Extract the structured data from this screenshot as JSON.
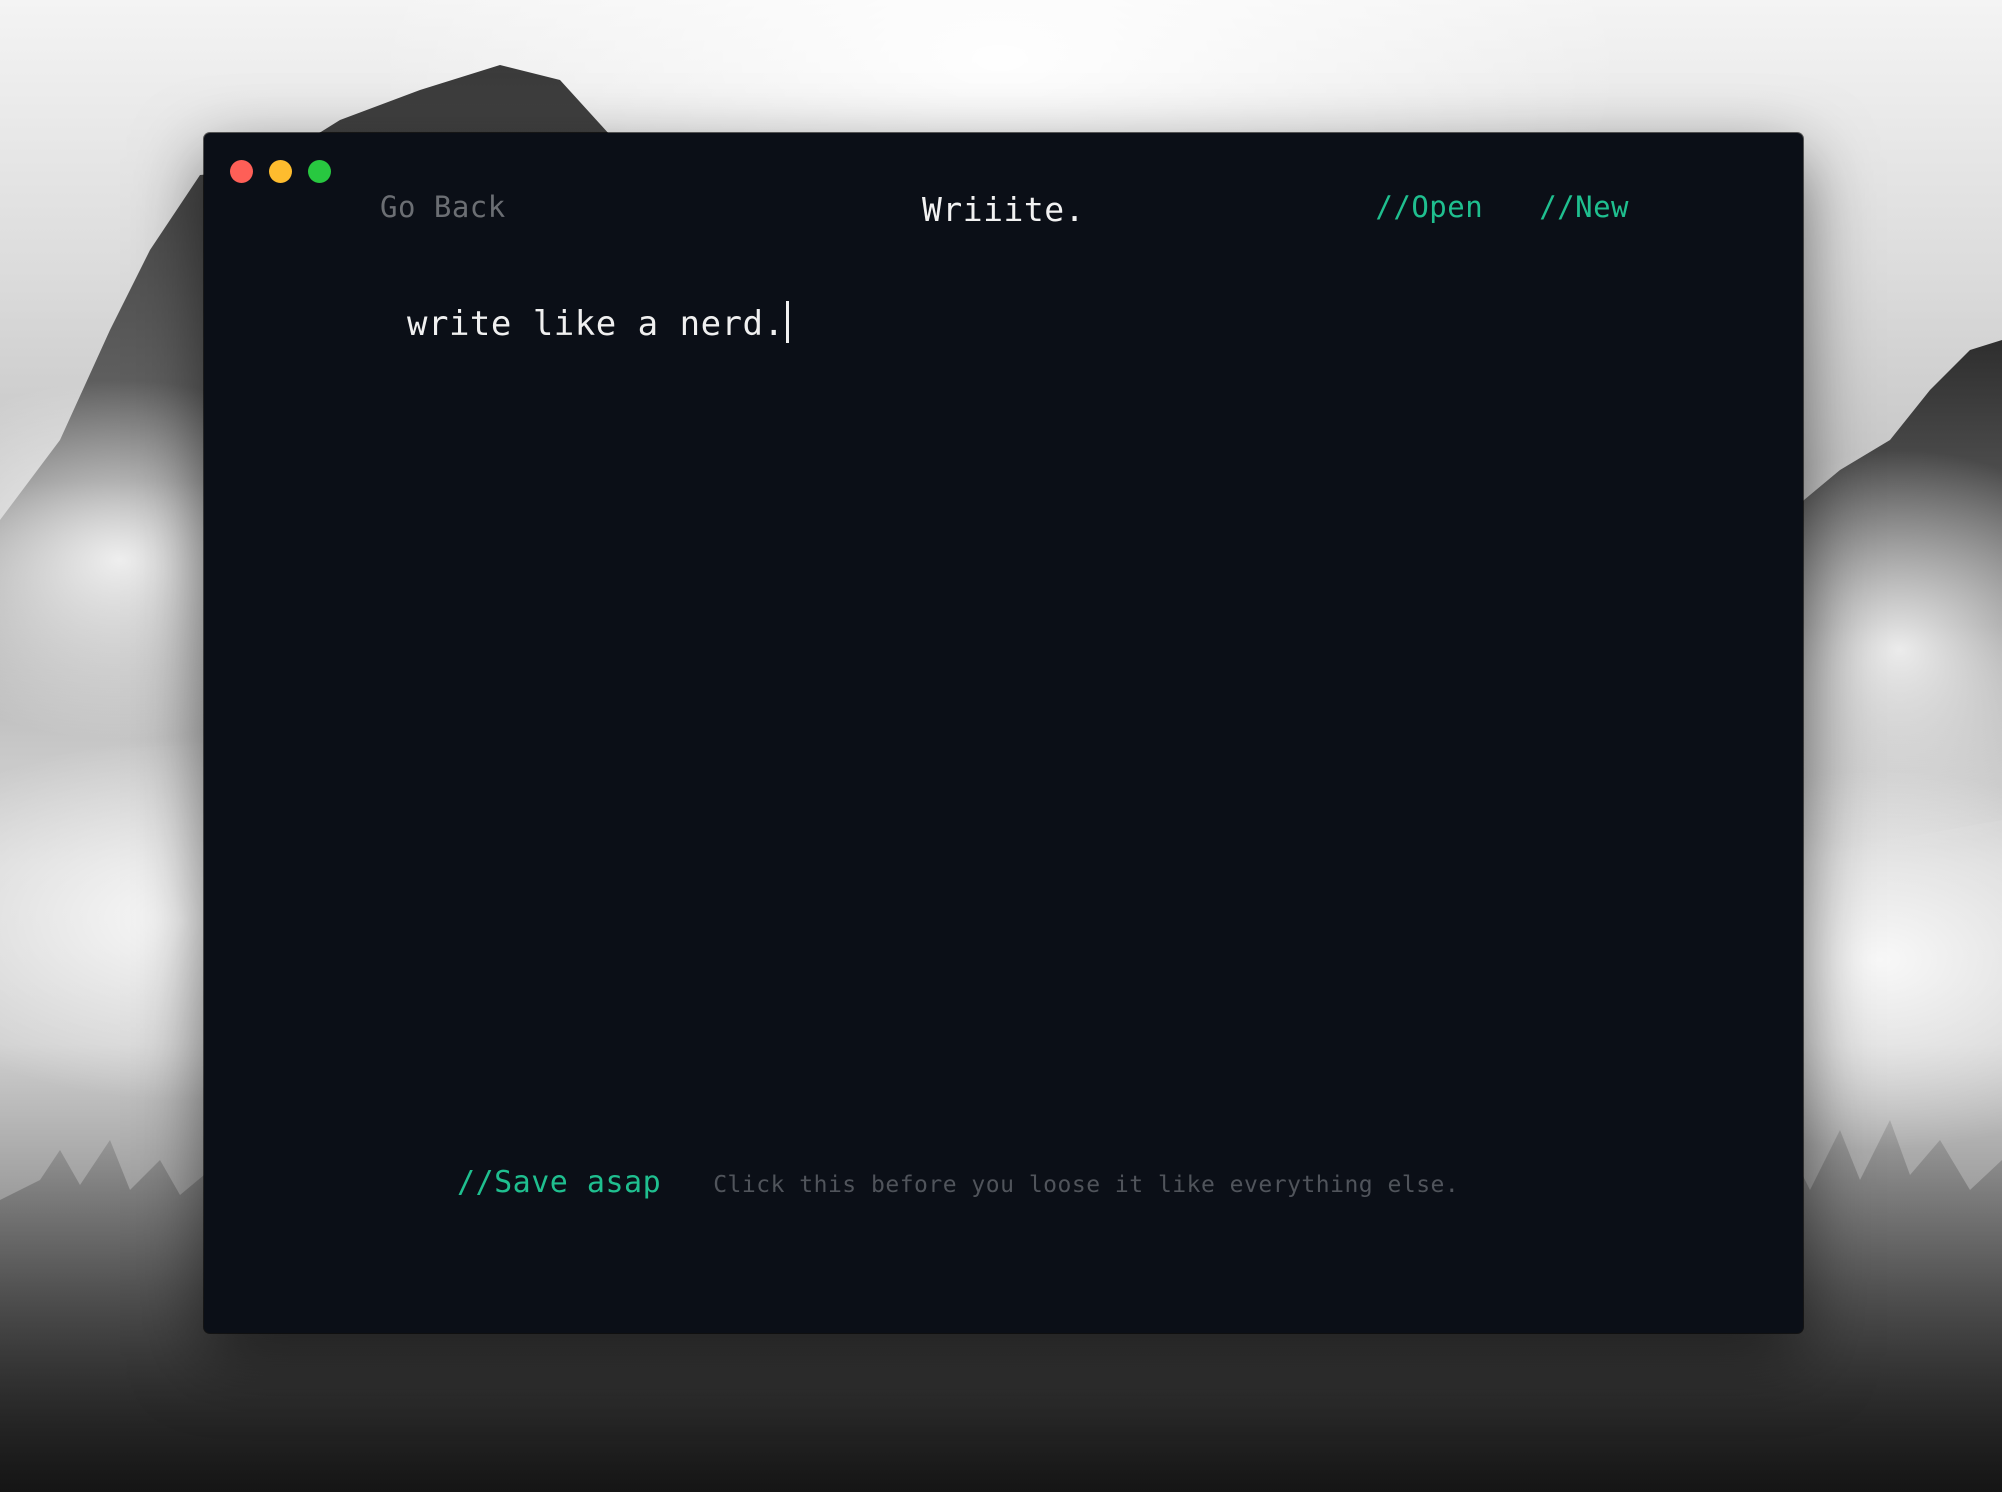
{
  "window": {
    "title": "Wriiite.",
    "background": "#0b0f17"
  },
  "traffic_lights": {
    "close_color": "#fe5f57",
    "minimize_color": "#febc2e",
    "zoom_color": "#28c840"
  },
  "nav": {
    "back_label": "Go Back",
    "open_label": "//Open",
    "new_label": "//New"
  },
  "editor": {
    "content": "write like a nerd."
  },
  "footer": {
    "save_label": "//Save asap",
    "hint": "Click this before you loose it like everything else."
  },
  "colors": {
    "accent": "#1fbf8f",
    "muted": "#6b6e73",
    "hint": "#50545b",
    "text": "#f0f0f0"
  }
}
